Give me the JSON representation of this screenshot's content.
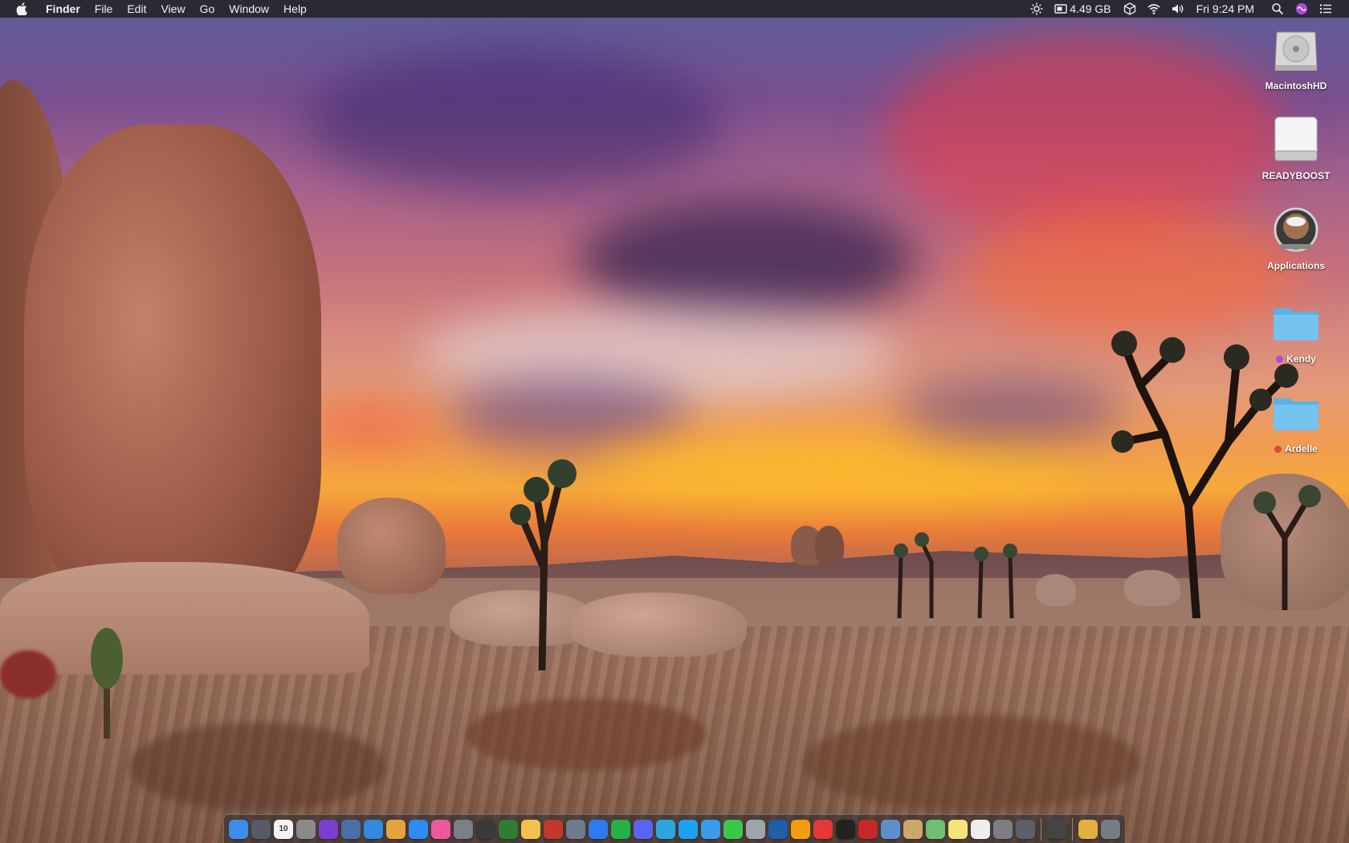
{
  "menubar": {
    "app_name": "Finder",
    "menus": [
      "File",
      "Edit",
      "View",
      "Go",
      "Window",
      "Help"
    ],
    "memory": "4.49 GB",
    "clock": "Fri 9:24 PM"
  },
  "desktop_icons": [
    {
      "label": "MacintoshHD",
      "icon": "hard-drive-icon"
    },
    {
      "label": "READYBOOST",
      "icon": "external-drive-icon"
    },
    {
      "label": "Applications",
      "icon": "applications-icon"
    },
    {
      "label": "Kendy",
      "icon": "folder-icon",
      "tag_color": "#b04bd6"
    },
    {
      "label": "Ardelle",
      "icon": "folder-icon",
      "tag_color": "#e0443e"
    }
  ],
  "dock": {
    "calendar_day": "10",
    "apps": [
      {
        "name": "finder",
        "color": "#3d8ee8"
      },
      {
        "name": "launchpad",
        "color": "#555a66"
      },
      {
        "name": "calendar",
        "color": "#f4f4f4"
      },
      {
        "name": "system-info",
        "color": "#8a8a8a"
      },
      {
        "name": "siri",
        "color": "#7a3fd0"
      },
      {
        "name": "photos-globe",
        "color": "#4a6fa8"
      },
      {
        "name": "safari",
        "color": "#2f8ae0"
      },
      {
        "name": "cyberduck",
        "color": "#e6a23c"
      },
      {
        "name": "app-store",
        "color": "#2d8cf0"
      },
      {
        "name": "itunes",
        "color": "#ec5a9c"
      },
      {
        "name": "rocket",
        "color": "#7a7f88"
      },
      {
        "name": "dashboard",
        "color": "#3a3a3a"
      },
      {
        "name": "activity",
        "color": "#2e7d32"
      },
      {
        "name": "photos",
        "color": "#f0c14b"
      },
      {
        "name": "photo-booth",
        "color": "#c0392b"
      },
      {
        "name": "preview",
        "color": "#6d7b8c"
      },
      {
        "name": "messenger",
        "color": "#2c7bf0"
      },
      {
        "name": "whatsapp",
        "color": "#25b14a"
      },
      {
        "name": "discord",
        "color": "#5865f2"
      },
      {
        "name": "telegram",
        "color": "#2ca5e0"
      },
      {
        "name": "twitter",
        "color": "#1da1f2"
      },
      {
        "name": "tweetbot",
        "color": "#3b9be8"
      },
      {
        "name": "facetime",
        "color": "#3ac84a"
      },
      {
        "name": "disk-utility",
        "color": "#9ea4ab"
      },
      {
        "name": "quicktime",
        "color": "#1f5fa8"
      },
      {
        "name": "home",
        "color": "#f39c12"
      },
      {
        "name": "news",
        "color": "#e53935"
      },
      {
        "name": "stocks",
        "color": "#222222"
      },
      {
        "name": "photo-tool",
        "color": "#c62828"
      },
      {
        "name": "preview-2",
        "color": "#5d8fcf"
      },
      {
        "name": "contacts",
        "color": "#c9a86a"
      },
      {
        "name": "maps",
        "color": "#6fbf73"
      },
      {
        "name": "notes",
        "color": "#f7e27b"
      },
      {
        "name": "textedit",
        "color": "#eeeeee"
      },
      {
        "name": "system-preferences",
        "color": "#7b7f85"
      },
      {
        "name": "screen-recorder",
        "color": "#5a5f6a"
      },
      {
        "name": "mojave-app",
        "color": "#444444"
      },
      {
        "name": "folder-stack",
        "color": "#e0b040"
      },
      {
        "name": "trash",
        "color": "#777c82"
      }
    ]
  }
}
